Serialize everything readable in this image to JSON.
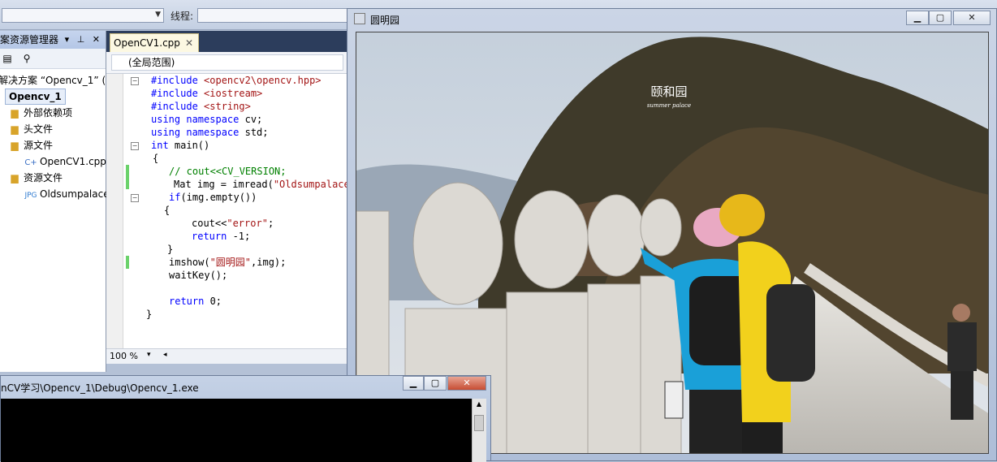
{
  "toolbar": {
    "thread_label": "线程:",
    "process_combo_value": "",
    "thread_combo_value": ""
  },
  "solution_explorer": {
    "title": "案资源管理器",
    "pin_buttons": "▾ ⊥ ✕",
    "solution_label": "解决方案 “Opencv_1” (:",
    "project": "Opencv_1",
    "items": [
      {
        "label": "外部依赖项",
        "icon": "folder-ref-icon"
      },
      {
        "label": "头文件",
        "icon": "folder-icon"
      },
      {
        "label": "源文件",
        "icon": "folder-open-icon"
      },
      {
        "label": "OpenCV1.cpp",
        "icon": "cpp-file-icon"
      },
      {
        "label": "资源文件",
        "icon": "folder-open-icon"
      },
      {
        "label": "Oldsumpalace",
        "icon": "image-file-icon"
      }
    ]
  },
  "editor": {
    "tab_label": "OpenCV1.cpp",
    "tab_close": "✕",
    "scope": "(全局范围)",
    "zoom": "100 %",
    "code": {
      "l1a": "#include",
      "l1b": " <opencv2\\opencv.hpp>",
      "l2a": "#include",
      "l2b": " <iostream>",
      "l3a": "#include",
      "l3b": " <string>",
      "l4a": "using namespace",
      "l4b": " cv;",
      "l5a": "using namespace",
      "l5b": " std;",
      "l6a": "int",
      "l6b": " main()",
      "l7": "{",
      "l8": "// cout<<CV_VERSION;",
      "l9a": "Mat img = imread(",
      "l9b": "\"Oldsumpalace",
      "l10a": "if",
      "l10b": "(img.empty())",
      "l11": "{",
      "l12a": "cout<<",
      "l12b": "\"error\"",
      "l12c": ";",
      "l13a": "return",
      "l13b": " -1;",
      "l14": "}",
      "l15a": "imshow(",
      "l15b": "\"圆明园\"",
      "l15c": ",img);",
      "l16": "waitKey();",
      "l17a": "return",
      "l17b": " 0;",
      "l18": "}"
    }
  },
  "image_window": {
    "title": "圆明园",
    "minimize": "▁",
    "maximize": "▢",
    "close": "✕",
    "watermark_title": "颐和园",
    "watermark_sub": "summer palace"
  },
  "console": {
    "title": "nCV学习\\Opencv_1\\Debug\\Opencv_1.exe",
    "minimize": "▁",
    "maximize": "▢",
    "close": "✕"
  }
}
